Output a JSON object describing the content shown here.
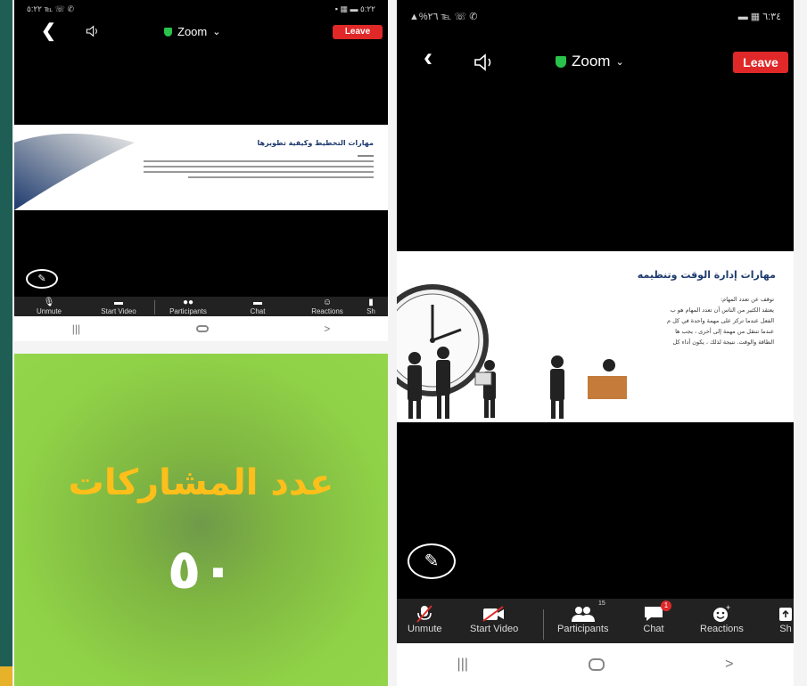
{
  "phone_a": {
    "status_left": "٥:٢٢ ℡ ☏ ✆",
    "status_right": "▪ ▦ ▬ ٥:٢٢",
    "meeting_title": "Zoom",
    "leave_label": "Leave",
    "slide_title": "مهارات التخطيط وكيفية تطويرها",
    "toolbar": [
      "Unmute",
      "Start Video",
      "Participants",
      "Chat",
      "Reactions",
      "Sh"
    ],
    "nav": [
      "|||",
      "○",
      ">"
    ]
  },
  "phone_b": {
    "status_left": "▲%٢٦ ℡ ☏ ✆",
    "status_right": "▬ ▦ ٦:٣٤",
    "meeting_title": "Zoom",
    "leave_label": "Leave",
    "slide_title": "مهارات إدارة الوقت وتنظيمه",
    "slide_lines": [
      "توقف عن تعدد المهام:",
      "يعتقد الكثير من الناس أن تعدد المهام هو ب",
      "الفعل عندما تركز على مهمة واحدة في كل م",
      "عندما تنتقل من مهمة إلى أخرى ، يجب ها",
      "الطاقة والوقت. نتيجة لذلك ، يكون أداء كل"
    ],
    "toolbar": {
      "unmute": "Unmute",
      "start_video": "Start Video",
      "participants": "Participants",
      "participants_count": "15",
      "chat": "Chat",
      "chat_badge": "1",
      "reactions": "Reactions",
      "share": "Sh"
    },
    "nav": [
      "|||",
      "○",
      ">"
    ]
  },
  "info_panel": {
    "title": "عدد المشاركات",
    "count": "٥٠"
  },
  "colors": {
    "leave_red": "#e02828",
    "panel_green": "#8fd147",
    "title_gold": "#ffbf1a",
    "strip_green": "#1f5e55"
  }
}
